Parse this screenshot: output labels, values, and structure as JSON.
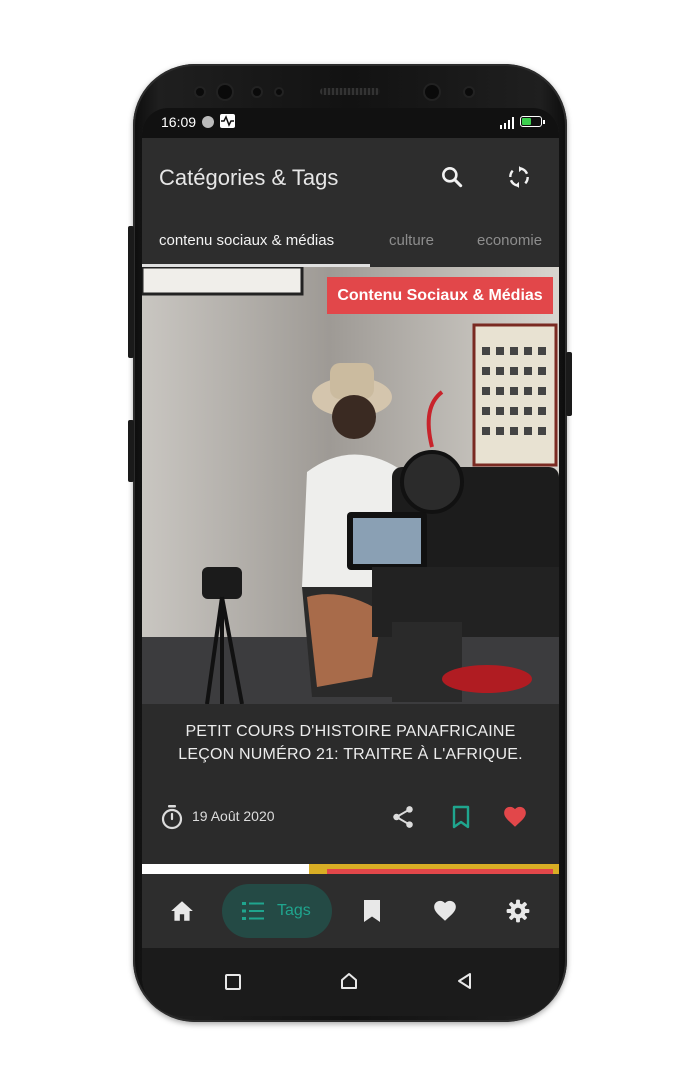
{
  "status_bar": {
    "time": "16:09"
  },
  "app_bar": {
    "title": "Catégories & Tags",
    "search_icon": "search-icon",
    "refresh_icon": "sync-icon"
  },
  "tabs": [
    {
      "label": "contenu sociaux & médias",
      "active": true
    },
    {
      "label": "culture",
      "active": false
    },
    {
      "label": "economie",
      "active": false
    }
  ],
  "article": {
    "category_badge": "Contenu Sociaux & Médias",
    "title_line1": "PETIT COURS D'HISTOIRE PANAFRICAINE",
    "title_line2": "LEÇON NUMÉRO 21: TRAITRE À L'AFRIQUE.",
    "date": "19 Août 2020",
    "liked": true
  },
  "bottom_nav": {
    "home_icon": "home-icon",
    "tags_label": "Tags",
    "bookmark_icon": "bookmark-icon",
    "favorites_icon": "heart-icon",
    "settings_icon": "settings-icon"
  },
  "colors": {
    "accent": "#1fa58e",
    "badge_red": "#e2474a",
    "heart_red": "#e2474a",
    "background": "#2d2d2d"
  }
}
